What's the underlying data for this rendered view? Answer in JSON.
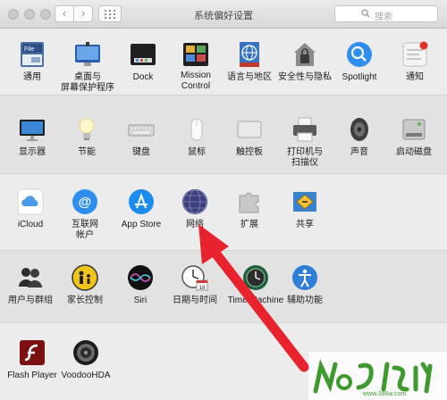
{
  "window": {
    "title": "系统偏好设置",
    "search_placeholder": "搜索"
  },
  "sections": [
    {
      "items": [
        {
          "label": "通用",
          "icon": "general-icon"
        },
        {
          "label": "桌面与\n屏幕保护程序",
          "icon": "desktop-screensaver-icon"
        },
        {
          "label": "Dock",
          "icon": "dock-icon"
        },
        {
          "label": "Mission\nControl",
          "icon": "mission-control-icon"
        },
        {
          "label": "语言与地区",
          "icon": "language-region-icon"
        },
        {
          "label": "安全性与隐私",
          "icon": "security-privacy-icon"
        },
        {
          "label": "Spotlight",
          "icon": "spotlight-icon"
        },
        {
          "label": "通知",
          "icon": "notifications-icon"
        }
      ]
    },
    {
      "items": [
        {
          "label": "显示器",
          "icon": "displays-icon"
        },
        {
          "label": "节能",
          "icon": "energy-saver-icon"
        },
        {
          "label": "键盘",
          "icon": "keyboard-icon"
        },
        {
          "label": "鼠标",
          "icon": "mouse-icon"
        },
        {
          "label": "触控板",
          "icon": "trackpad-icon"
        },
        {
          "label": "打印机与\n扫描仪",
          "icon": "printers-scanners-icon"
        },
        {
          "label": "声音",
          "icon": "sound-icon"
        },
        {
          "label": "启动磁盘",
          "icon": "startup-disk-icon"
        }
      ]
    },
    {
      "items": [
        {
          "label": "iCloud",
          "icon": "icloud-icon"
        },
        {
          "label": "互联网\n帐户",
          "icon": "internet-accounts-icon"
        },
        {
          "label": "App Store",
          "icon": "app-store-icon"
        },
        {
          "label": "网络",
          "icon": "network-icon"
        },
        {
          "label": "扩展",
          "icon": "extensions-icon"
        },
        {
          "label": "共享",
          "icon": "sharing-icon"
        }
      ]
    },
    {
      "items": [
        {
          "label": "用户与群组",
          "icon": "users-groups-icon"
        },
        {
          "label": "家长控制",
          "icon": "parental-controls-icon"
        },
        {
          "label": "Siri",
          "icon": "siri-icon"
        },
        {
          "label": "日期与时间",
          "icon": "date-time-icon"
        },
        {
          "label": "Time Machine",
          "icon": "time-machine-icon"
        },
        {
          "label": "辅助功能",
          "icon": "accessibility-icon"
        }
      ]
    },
    {
      "items": [
        {
          "label": "Flash Player",
          "icon": "flash-player-icon"
        },
        {
          "label": "VoodooHDA",
          "icon": "voodoohda-icon"
        }
      ]
    }
  ],
  "watermark": {
    "text": "www.386w.com"
  }
}
